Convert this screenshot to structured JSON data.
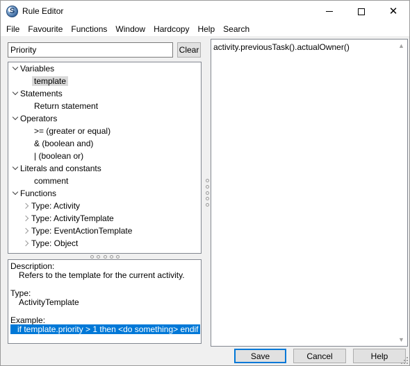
{
  "window": {
    "title": "Rule Editor"
  },
  "menu": [
    "File",
    "Favourite",
    "Functions",
    "Window",
    "Hardcopy",
    "Help",
    "Search"
  ],
  "search": {
    "value": "Priority",
    "clear_label": "Clear"
  },
  "tree": {
    "variables": {
      "label": "Variables",
      "items": [
        "template"
      ]
    },
    "statements": {
      "label": "Statements",
      "items": [
        "Return statement"
      ]
    },
    "operators": {
      "label": "Operators",
      "items": [
        ">= (greater or equal)",
        "& (boolean and)",
        "| (boolean or)"
      ]
    },
    "literals": {
      "label": "Literals and constants",
      "items": [
        "comment"
      ]
    },
    "functions": {
      "label": "Functions",
      "items": [
        "Type: Activity",
        "Type: ActivityTemplate",
        "Type: EventActionTemplate",
        "Type: Object"
      ]
    }
  },
  "description": {
    "description_label": "Description:",
    "description_text": "Refers to the template for the current activity.",
    "type_label": "Type:",
    "type_text": "ActivityTemplate",
    "example_label": "Example:",
    "example_text": "if template.priority > 1 then <do something> endif"
  },
  "editor": {
    "text": "activity.previousTask().actualOwner()"
  },
  "buttons": {
    "save": "Save",
    "cancel": "Cancel",
    "help": "Help"
  },
  "colors": {
    "selection": "#0078d7",
    "tree_selected": "#d9d9d9"
  }
}
